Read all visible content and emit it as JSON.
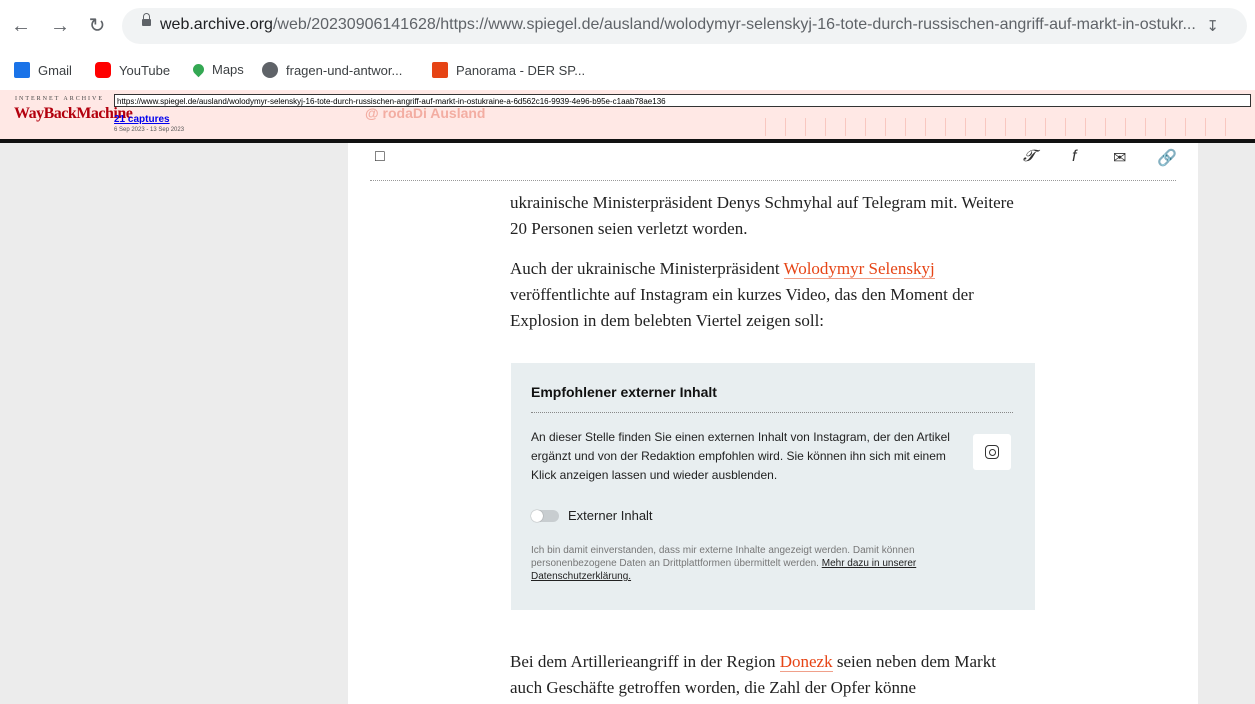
{
  "browser": {
    "url_host": "web.archive.org",
    "url_path": "/web/20230906141628/https://www.spiegel.de/ausland/wolodymyr-selenskyj-16-tote-durch-russischen-angriff-auf-markt-in-ostukr...",
    "back_icon": "back-arrow-icon",
    "forward_icon": "forward-arrow-icon",
    "reload_icon": "reload-icon"
  },
  "bookmarks": [
    {
      "label": "Gmail",
      "icon": "gmail-icon",
      "color": "#1a73e8"
    },
    {
      "label": "YouTube",
      "icon": "youtube-icon",
      "color": "#ff0000"
    },
    {
      "label": "Maps",
      "icon": "maps-icon",
      "color": "#34a853"
    },
    {
      "label": "fragen-und-antwor...",
      "icon": "globe-icon",
      "color": "#5f6368"
    },
    {
      "label": "Panorama - DER SP...",
      "icon": "spiegel-icon",
      "color": "#e64415"
    }
  ],
  "wayback": {
    "ia_label": "INTERNET ARCHIVE",
    "logo_text": "WayBackMachine",
    "url_value": "https://www.spiegel.de/ausland/wolodymyr-selenskyj-16-tote-durch-russischen-angriff-auf-markt-in-ostukraine-a-6d562c16-9939-4e96-b95e-c1aab78ae136",
    "captures": "21 captures",
    "date_range": "6 Sep 2023 - 13 Sep 2023",
    "ghost_text": "@ rodaDi Ausland"
  },
  "article": {
    "para1": "ukrainische Ministerpräsident Denys Schmyhal auf Telegram mit. Weitere 20 Personen seien verletzt worden.",
    "para2_before": "Auch der ukrainische Ministerpräsident ",
    "para2_link": "Wolodymyr Selenskyj",
    "para2_after": " veröffentlichte auf Instagram ein kurzes Video, das den Moment der Explosion in dem belebten Viertel zeigen soll:",
    "para3_before": "Bei dem Artillerieangriff in der Region ",
    "para3_link": "Donezk",
    "para3_after": " seien neben dem Markt auch Geschäfte getroffen worden, die Zahl der Opfer könne"
  },
  "embed": {
    "title": "Empfohlener externer Inhalt",
    "body": "An dieser Stelle finden Sie einen externen Inhalt von Instagram, der den Artikel ergänzt und von der Redaktion empfohlen wird. Sie können ihn sich mit einem Klick anzeigen lassen und wieder ausblenden.",
    "toggle_label": "Externer Inhalt",
    "consent_text": "Ich bin damit einverstanden, dass mir externe Inhalte angezeigt werden. Damit können personenbezogene Daten an Drittplattformen übermittelt werden. ",
    "consent_link": "Mehr dazu in unserer Datenschutzerklärung."
  }
}
